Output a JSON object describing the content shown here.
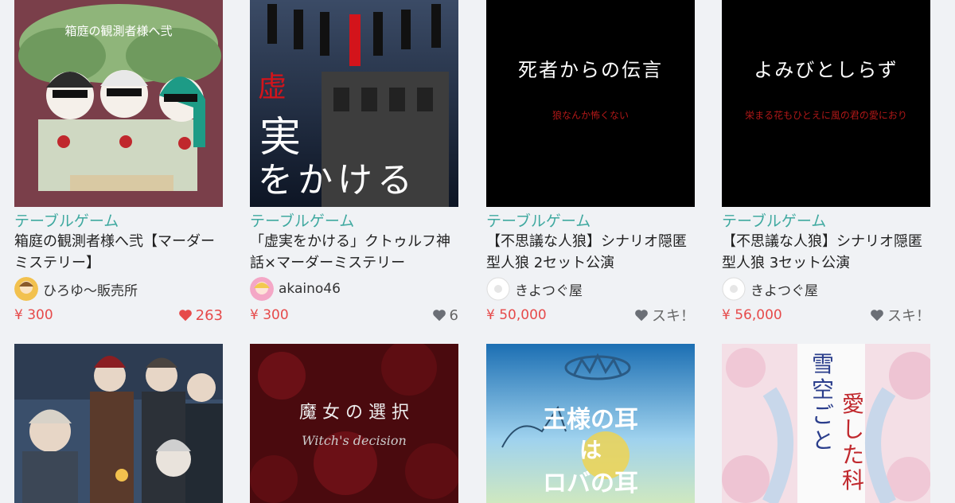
{
  "products": [
    {
      "category": "テーブルゲーム",
      "title": "箱庭の観測者様へ弐【マーダーミステリー】",
      "seller": "ひろゆ～販売所",
      "price": "¥ 300",
      "like_label": "263",
      "liked": true,
      "cover_text": "箱庭の観測者様へ弐"
    },
    {
      "category": "テーブルゲーム",
      "title": "「虚実をかける」クトゥルフ神話×マーダーミステリー",
      "seller": "akaino46",
      "price": "¥ 300",
      "like_label": "6",
      "liked": false,
      "cover_text_top": "虚",
      "cover_text_main": "実",
      "cover_text_bottom": "をかける"
    },
    {
      "category": "テーブルゲーム",
      "title": "【不思議な人狼】シナリオ隠匿型人狼 2セット公演",
      "seller": "きよつぐ屋",
      "price": "¥ 50,000",
      "like_label": "スキ！",
      "liked": false,
      "cover_text": "死者からの伝言",
      "cover_subtext": "狼なんか怖くない"
    },
    {
      "category": "テーブルゲーム",
      "title": "【不思議な人狼】シナリオ隠匿型人狼 3セット公演",
      "seller": "きよつぐ屋",
      "price": "¥ 56,000",
      "like_label": "スキ！",
      "liked": false,
      "cover_text": "よみびとしらず",
      "cover_subtext": "栄まる花もひとえに風の君の愛におり"
    },
    {
      "cover_text": ""
    },
    {
      "cover_text": "魔 女 の 選 択",
      "cover_subtext": "Witch's decision"
    },
    {
      "cover_text_top": "王様の耳",
      "cover_text_mid": "は",
      "cover_text_bottom": "ロバの耳"
    },
    {
      "cover_text_a": "雪空ごと",
      "cover_text_b": "愛した科"
    }
  ],
  "colors": {
    "category": "#3fa9a0",
    "price": "#e64a4a",
    "liked_heart": "#e64a4a",
    "heart": "#6b6f76",
    "background": "#f0f2f5"
  }
}
